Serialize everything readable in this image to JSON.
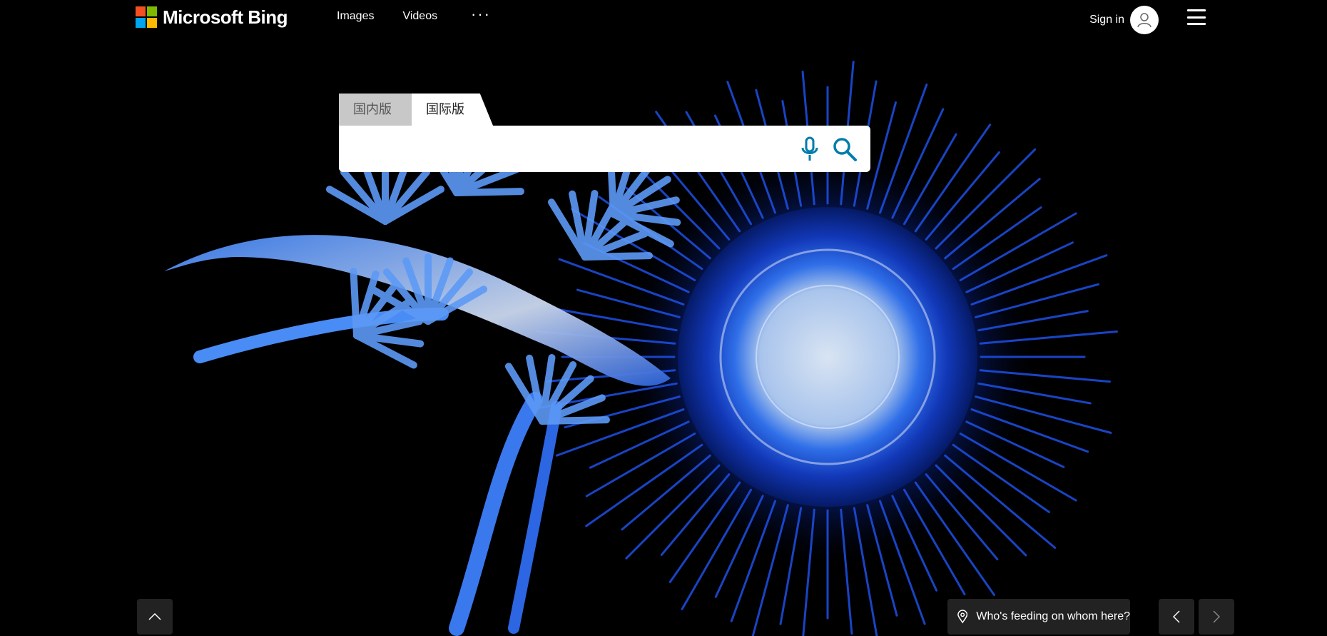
{
  "brand": {
    "name": "Microsoft Bing",
    "colors": {
      "red": "#f25022",
      "green": "#7fba00",
      "blue": "#00a4ef",
      "yellow": "#ffb900"
    }
  },
  "nav": {
    "items": [
      {
        "label": "Images"
      },
      {
        "label": "Videos"
      }
    ],
    "more_label": "···"
  },
  "account": {
    "signin_label": "Sign in"
  },
  "search": {
    "tabs": [
      {
        "label": "国内版",
        "active": false
      },
      {
        "label": "国际版",
        "active": true
      }
    ],
    "input_value": "",
    "accent_color": "#007daa"
  },
  "image_caption": {
    "text": "Who's feeding on whom here?"
  },
  "icons": {
    "menu": "hamburger-icon",
    "avatar": "person-icon",
    "mic": "microphone-icon",
    "search": "search-icon",
    "scroll_up": "chevron-up-icon",
    "location": "location-pin-icon",
    "previous": "chevron-left-icon",
    "next": "chevron-right-icon"
  }
}
